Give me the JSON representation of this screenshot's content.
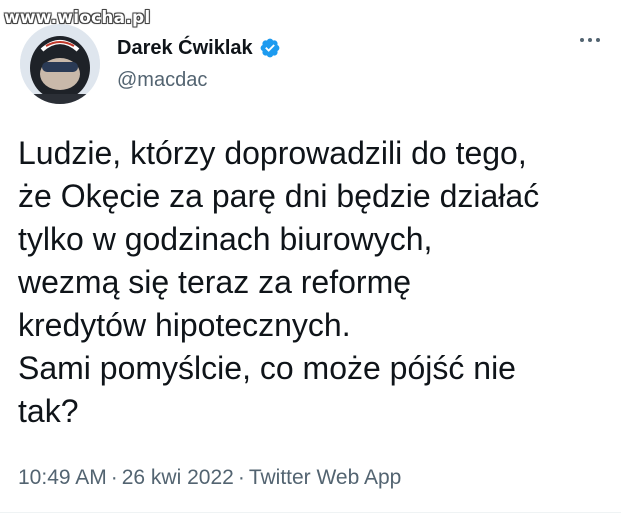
{
  "watermark": "www.wiocha.pl",
  "author": {
    "display_name": "Darek Ćwiklak",
    "handle": "@macdac",
    "verified": true
  },
  "tweet": {
    "lines": [
      "Ludzie, którzy doprowadzili do tego,",
      "że Okęcie za parę dni będzie działać",
      "tylko w godzinach biurowych,",
      "wezmą się teraz za reformę",
      "kredytów hipotecznych.",
      "Sami pomyślcie, co może pójść nie",
      "tak?"
    ],
    "time": "10:49 AM",
    "date": "26 kwi 2022",
    "source": "Twitter Web App",
    "separator": "·"
  },
  "icons": {
    "verified": "verified-badge-icon",
    "more": "more-options-icon"
  },
  "colors": {
    "text_primary": "#0f1419",
    "text_secondary": "#536471",
    "verified_blue": "#1d9bf0"
  }
}
